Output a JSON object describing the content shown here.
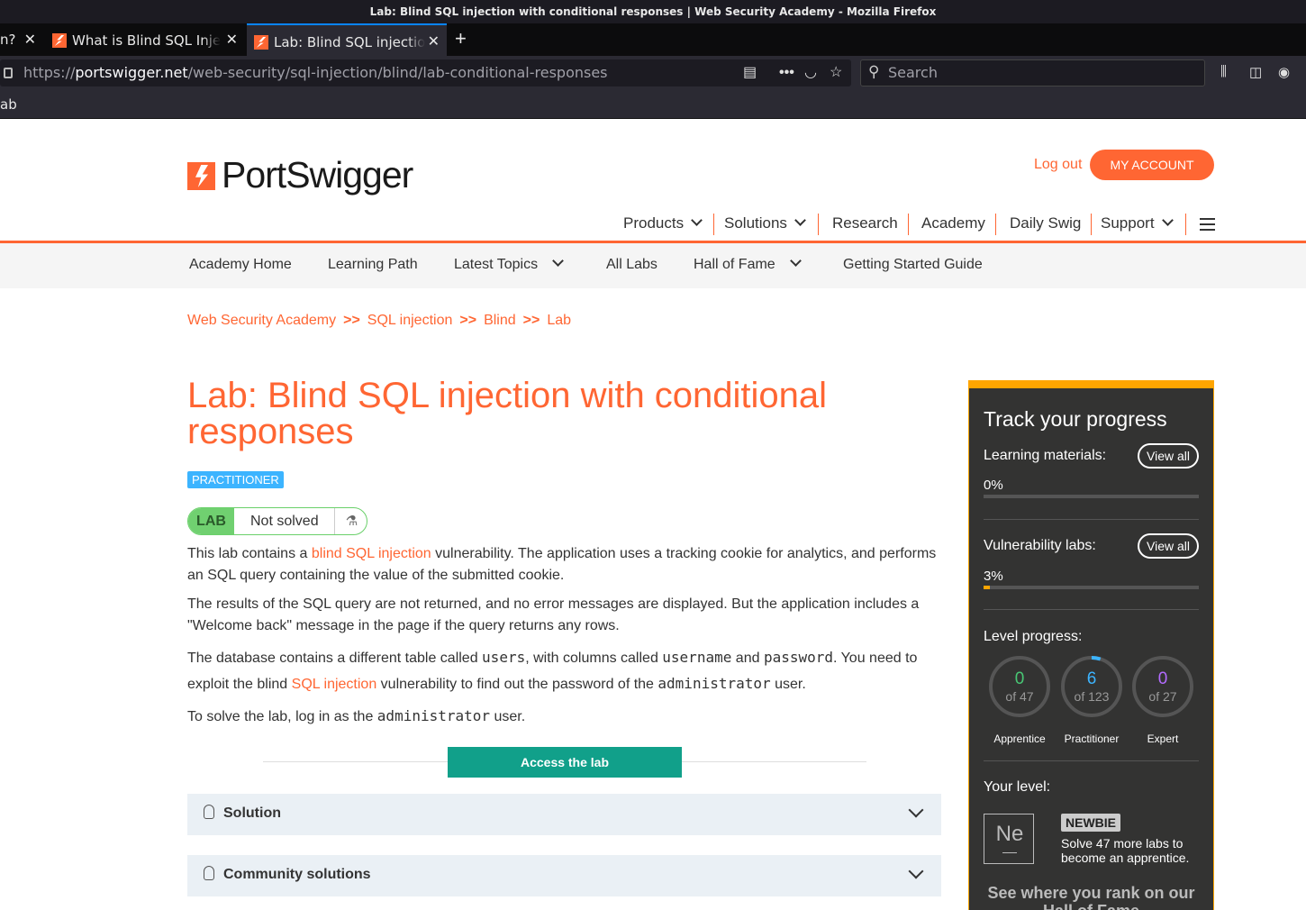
{
  "browser": {
    "window_title": "Lab: Blind SQL injection with conditional responses | Web Security Academy - Mozilla Firefox",
    "tabs": [
      {
        "label": "n?",
        "close": "✕"
      },
      {
        "label": "What is Blind SQL Injection?",
        "close": "✕"
      },
      {
        "label": "Lab: Blind SQL injection with conditional responses",
        "close": "✕"
      }
    ],
    "new_tab": "+",
    "url_prefix": "https://",
    "url_host": "portswigger.net",
    "url_path": "/web-security/sql-injection/blind/lab-conditional-responses",
    "search_placeholder": "Search",
    "bookmark_text": "ab"
  },
  "header": {
    "logo_text": "PortSwigger",
    "logout": "Log out",
    "my_account": "MY ACCOUNT",
    "nav": [
      "Products",
      "Solutions",
      "Research",
      "Academy",
      "Daily Swig",
      "Support"
    ],
    "subnav": [
      "Academy Home",
      "Learning Path",
      "Latest Topics",
      "All Labs",
      "Hall of Fame",
      "Getting Started Guide"
    ]
  },
  "breadcrumbs": [
    "Web Security Academy",
    "SQL injection",
    "Blind",
    "Lab"
  ],
  "breadcrumb_separator": ">>",
  "lab": {
    "title": "Lab: Blind SQL injection with conditional responses",
    "level": "PRACTITIONER",
    "status_tag": "LAB",
    "status": "Not solved",
    "p1_a": "This lab contains a ",
    "p1_link": "blind SQL injection",
    "p1_b": " vulnerability. The application uses a tracking cookie for analytics, and performs an SQL query containing the value of the submitted cookie.",
    "p2": "The results of the SQL query are not returned, and no error messages are displayed. But the application includes a \"Welcome back\" message in the page if the query returns any rows.",
    "p3_a": "The database contains a different table called ",
    "p3_code1": "users",
    "p3_b": ", with columns called ",
    "p3_code2": "username",
    "p3_c": " and ",
    "p3_code3": "password",
    "p3_d": ". You need to exploit the blind ",
    "p3_link": "SQL injection",
    "p3_e": " vulnerability to find out the password of the ",
    "p3_code4": "administrator",
    "p3_f": " user.",
    "p4_a": "To solve the lab, log in as the ",
    "p4_code": "administrator",
    "p4_b": " user.",
    "access_button": "Access the lab",
    "solution": "Solution",
    "community": "Community solutions"
  },
  "progress": {
    "title": "Track your progress",
    "learning_label": "Learning materials:",
    "learning_pct": "0%",
    "learning_value": 0,
    "vuln_label": "Vulnerability labs:",
    "vuln_pct": "3%",
    "vuln_value": 3,
    "view_all": "View all",
    "level_label": "Level progress:",
    "levels": [
      {
        "name": "Apprentice",
        "count": "0",
        "of": "of 47",
        "color": "#48c774",
        "fraction": 0
      },
      {
        "name": "Practitioner",
        "count": "6",
        "of": "of 123",
        "color": "#3cb4ff",
        "fraction": 0.049
      },
      {
        "name": "Expert",
        "count": "0",
        "of": "of 27",
        "color": "#b36bff",
        "fraction": 0
      }
    ],
    "your_level_label": "Your level:",
    "level_symbol": "Ne",
    "level_name": "NEWBIE",
    "level_desc": "Solve 47 more labs to become an apprentice.",
    "rank_text": "See where you rank on our Hall of Fame"
  },
  "colors": {
    "brand": "#ff6633",
    "access": "#11a08a",
    "progress_accent": "#ffa500"
  }
}
